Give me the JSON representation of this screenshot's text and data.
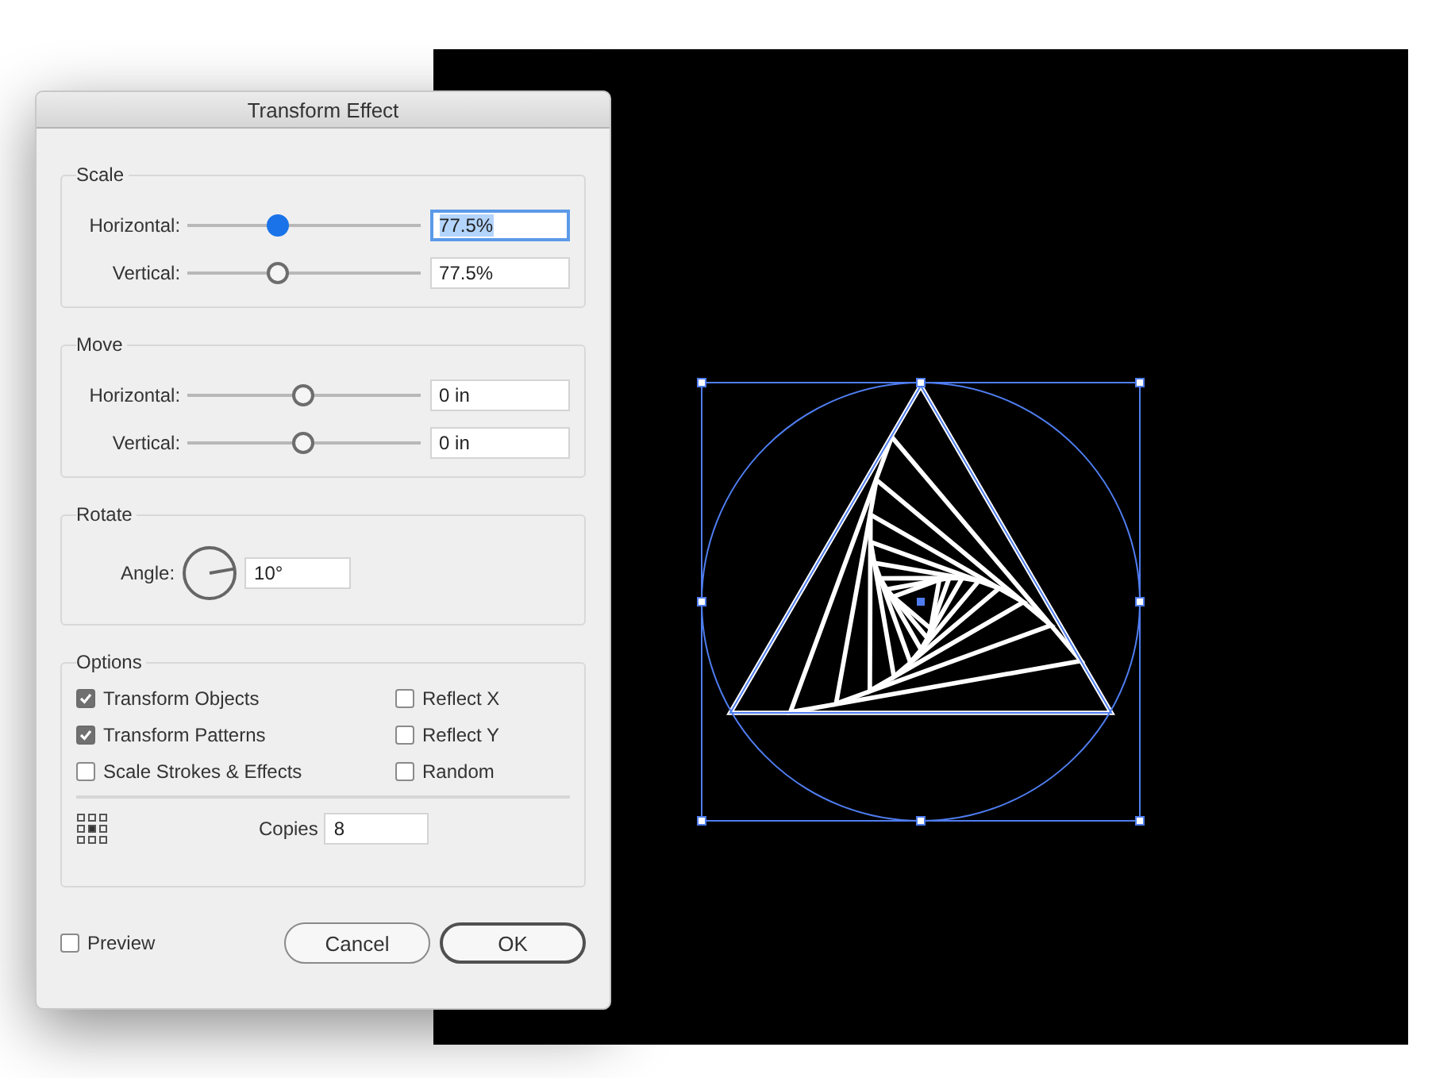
{
  "window": {
    "title": "Transform Effect"
  },
  "groups": [
    {
      "title": "Scale",
      "rows": [
        {
          "label": "Horizontal:",
          "level": 0.39,
          "value": "77.5%",
          "focused": true
        },
        {
          "label": "Vertical:",
          "level": 0.39,
          "value": "77.5%",
          "focused": false
        }
      ]
    },
    {
      "title": "Move",
      "rows": [
        {
          "label": "Horizontal:",
          "level": 0.5,
          "value": "0 in",
          "focused": false
        },
        {
          "label": "Vertical:",
          "level": 0.5,
          "value": "0 in",
          "focused": false
        }
      ]
    }
  ],
  "rotate": {
    "title": "Rotate",
    "label": "Angle:",
    "value": "10°"
  },
  "options": {
    "title": "Options",
    "checkboxes": [
      {
        "label": "Transform Objects",
        "checked": true
      },
      {
        "label": "Reflect X",
        "checked": false
      },
      {
        "label": "Transform Patterns",
        "checked": true
      },
      {
        "label": "Reflect Y",
        "checked": false
      },
      {
        "label": "Scale Strokes & Effects",
        "checked": false
      },
      {
        "label": "Random",
        "checked": false
      }
    ],
    "copies": {
      "label": "Copies",
      "value": "8"
    }
  },
  "preview": {
    "label": "Preview",
    "checked": false
  },
  "buttons": [
    {
      "label": "Cancel",
      "default": false
    },
    {
      "label": "OK",
      "default": true
    }
  ]
}
